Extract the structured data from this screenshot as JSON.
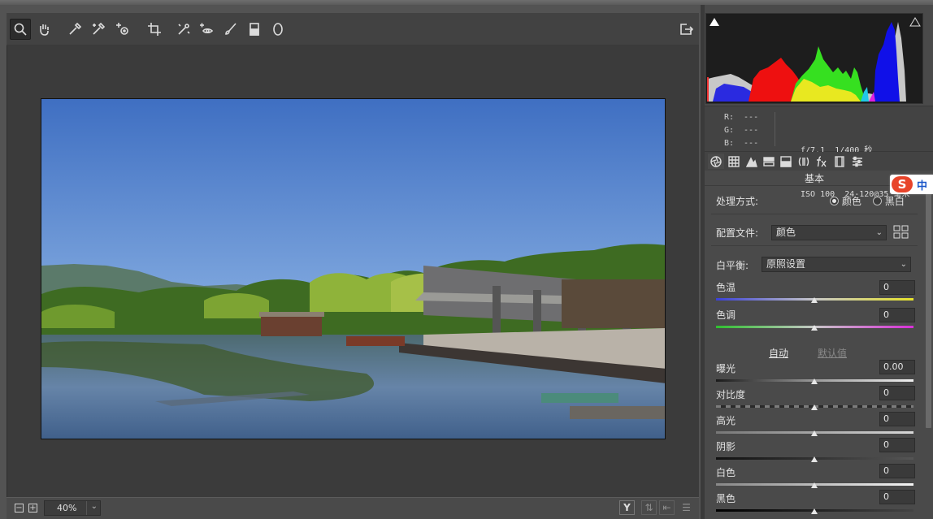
{
  "toolbar": {
    "tools": [
      "zoom-tool",
      "hand-tool",
      "white-balance-tool",
      "color-sampler-tool",
      "targeted-adjustment-tool",
      "crop-tool",
      "straighten-tool",
      "spot-removal-tool",
      "red-eye-tool",
      "adjustment-brush-tool",
      "graduated-filter-tool",
      "radial-filter-tool"
    ],
    "open_prefs": "open-preferences-icon"
  },
  "bottom": {
    "zoom_value": "40%",
    "zoom_out": "−",
    "zoom_in": "+",
    "view_y": "Y"
  },
  "readout": {
    "r_label": "R:",
    "r_value": "---",
    "g_label": "G:",
    "g_value": "---",
    "b_label": "B:",
    "b_value": "---"
  },
  "exif": {
    "aperture": "f/7.1",
    "shutter": "1/400 秒",
    "iso": "ISO 100",
    "lens": "24-120@35 毫米"
  },
  "panel": {
    "title": "基本",
    "treatment_label": "处理方式:",
    "treatment_color": "颜色",
    "treatment_bw": "黑白",
    "treatment_selected": "颜色",
    "profile_label": "配置文件:",
    "profile_value": "颜色",
    "wb_label": "白平衡:",
    "wb_value": "原照设置",
    "temp_label": "色温",
    "temp_value": "0",
    "tint_label": "色调",
    "tint_value": "0",
    "auto_label": "自动",
    "default_label": "默认值",
    "exposure_label": "曝光",
    "exposure_value": "0.00",
    "contrast_label": "对比度",
    "contrast_value": "0",
    "highlights_label": "高光",
    "highlights_value": "0",
    "shadows_label": "阴影",
    "shadows_value": "0",
    "whites_label": "白色",
    "whites_value": "0",
    "blacks_label": "黑色",
    "blacks_value": "0"
  },
  "ime": {
    "logo": "S",
    "mode": "中"
  },
  "colors": {
    "accent": "#e6e6e6",
    "panel_bg": "#4a4a4a",
    "canvas_bg": "#3b3b3b"
  }
}
